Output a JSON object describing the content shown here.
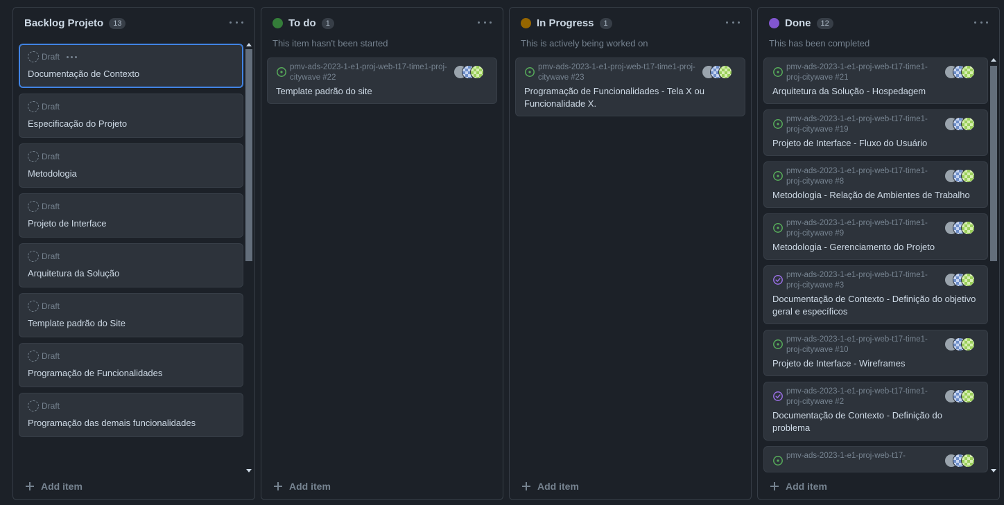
{
  "colors": {
    "todo": "#347d39",
    "in_progress": "#966600",
    "done": "#8256d0",
    "open_issue": "#57ab5a",
    "closed_issue": "#986ee2"
  },
  "columns": [
    {
      "title": "Backlog Projeto",
      "count": "13",
      "add_label": "Add item",
      "cards": [
        {
          "status": "Draft",
          "title": "Documentação de Contexto"
        },
        {
          "status": "Draft",
          "title": "Especificação do Projeto"
        },
        {
          "status": "Draft",
          "title": "Metodologia"
        },
        {
          "status": "Draft",
          "title": "Projeto de Interface"
        },
        {
          "status": "Draft",
          "title": "Arquitetura da Solução"
        },
        {
          "status": "Draft",
          "title": "Template padrão do Site"
        },
        {
          "status": "Draft",
          "title": "Programação de Funcionalidades"
        },
        {
          "status": "Draft",
          "title": "Programação das demais funcionalidades"
        }
      ]
    },
    {
      "title": "To do",
      "count": "1",
      "description": "This item hasn't been started",
      "add_label": "Add item",
      "cards": [
        {
          "repo": "pmv-ads-2023-1-e1-proj-web-t17-time1-proj-citywave #22",
          "title": "Template padrão do site",
          "icon": "issue-open-icon"
        }
      ]
    },
    {
      "title": "In Progress",
      "count": "1",
      "description": "This is actively being worked on",
      "add_label": "Add item",
      "cards": [
        {
          "repo": "pmv-ads-2023-1-e1-proj-web-t17-time1-proj-citywave #23",
          "title": "Programação de Funcionalidades - Tela X ou Funcionalidade X.",
          "icon": "issue-open-icon"
        }
      ]
    },
    {
      "title": "Done",
      "count": "12",
      "description": "This has been completed",
      "add_label": "Add item",
      "cards": [
        {
          "repo": "pmv-ads-2023-1-e1-proj-web-t17-time1-proj-citywave #21",
          "title": "Arquitetura da Solução - Hospedagem",
          "icon": "issue-open-icon"
        },
        {
          "repo": "pmv-ads-2023-1-e1-proj-web-t17-time1-proj-citywave #19",
          "title": "Projeto de Interface - Fluxo do Usuário",
          "icon": "issue-open-icon"
        },
        {
          "repo": "pmv-ads-2023-1-e1-proj-web-t17-time1-proj-citywave #8",
          "title": "Metodologia - Relação de Ambientes de Trabalho",
          "icon": "issue-open-icon"
        },
        {
          "repo": "pmv-ads-2023-1-e1-proj-web-t17-time1-proj-citywave #9",
          "title": "Metodologia - Gerenciamento do Projeto",
          "icon": "issue-open-icon"
        },
        {
          "repo": "pmv-ads-2023-1-e1-proj-web-t17-time1-proj-citywave #3",
          "title": "Documentação de Contexto - Definição do objetivo geral e específicos",
          "icon": "issue-closed-icon"
        },
        {
          "repo": "pmv-ads-2023-1-e1-proj-web-t17-time1-proj-citywave #10",
          "title": "Projeto de Interface - Wireframes",
          "icon": "issue-open-icon"
        },
        {
          "repo": "pmv-ads-2023-1-e1-proj-web-t17-time1-proj-citywave #2",
          "title": "Documentação de Contexto - Definição do problema",
          "icon": "issue-closed-icon"
        },
        {
          "repo": "pmv-ads-2023-1-e1-proj-web-t17-",
          "title": "",
          "icon": "issue-open-icon"
        }
      ]
    }
  ]
}
